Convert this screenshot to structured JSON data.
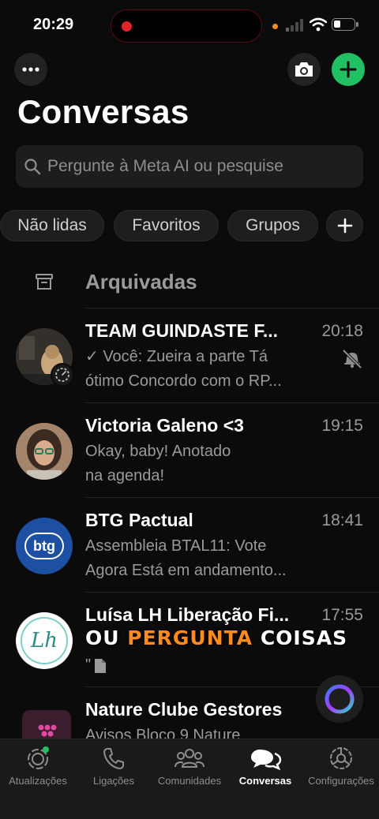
{
  "status_bar": {
    "time": "20:29"
  },
  "header": {
    "title": "Conversas"
  },
  "search": {
    "placeholder": "Pergunte à Meta AI ou pesquise"
  },
  "filters": [
    "Não lidas",
    "Favoritos",
    "Grupos"
  ],
  "archived": {
    "label": "Arquivadas"
  },
  "chats": [
    {
      "name": "TEAM GUINDASTE F...",
      "time": "20:18",
      "line1": "✓ Você: Zueira a parte  Tá",
      "line2": "ótimo  Concordo com o RP...",
      "muted": true
    },
    {
      "name": "Victoria Galeno <3",
      "time": "19:15",
      "line1": "Okay, baby! Anotado",
      "line2": "na agenda!"
    },
    {
      "name": "BTG Pactual",
      "time": "18:41",
      "line1": "Assembleia BTAL11: Vote",
      "line2": "Agora Está em andamento...",
      "avatar_text": "btg"
    },
    {
      "name": "Luísa LH Liberação Fi...",
      "time": "17:55",
      "line2": "\"",
      "avatar_text": "Lh"
    },
    {
      "name": "Nature Clube Gestores",
      "line1": "Avisos  Bloco 9 Nature"
    }
  ],
  "caption": {
    "part1": "OU ",
    "part2": "PERGUNTA",
    "part3": " COISAS"
  },
  "tabs": [
    {
      "label": "Atualizações",
      "icon": "updates-icon"
    },
    {
      "label": "Ligações",
      "icon": "phone-icon"
    },
    {
      "label": "Comunidades",
      "icon": "communities-icon"
    },
    {
      "label": "Conversas",
      "icon": "chats-icon",
      "active": true
    },
    {
      "label": "Configurações",
      "icon": "settings-icon"
    }
  ],
  "colors": {
    "accent": "#21c063",
    "background": "#0b0b0b",
    "btg_blue": "#1d4fa3",
    "caption_orange": "#ff8a1e"
  }
}
